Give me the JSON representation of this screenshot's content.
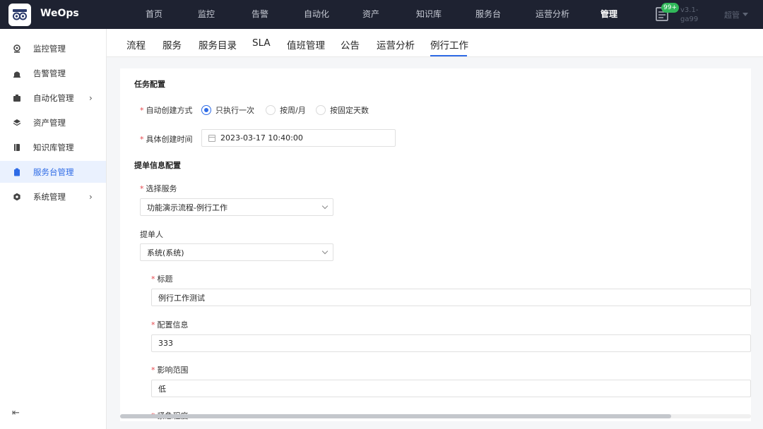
{
  "header": {
    "app_name": "WeOps",
    "nav": [
      "首页",
      "监控",
      "告警",
      "自动化",
      "资产",
      "知识库",
      "服务台",
      "运营分析",
      "管理"
    ],
    "active_nav": "管理",
    "notification_badge": "99+",
    "version_line1": "v3.1-",
    "version_line2": "ga99",
    "user": "超管"
  },
  "sidebar": {
    "items": [
      {
        "label": "监控管理",
        "icon": "monitor-icon"
      },
      {
        "label": "告警管理",
        "icon": "alarm-icon"
      },
      {
        "label": "自动化管理",
        "icon": "automation-icon",
        "has_children": true
      },
      {
        "label": "资产管理",
        "icon": "asset-icon"
      },
      {
        "label": "知识库管理",
        "icon": "book-icon"
      },
      {
        "label": "服务台管理",
        "icon": "clipboard-icon",
        "active": true
      },
      {
        "label": "系统管理",
        "icon": "settings-icon",
        "has_children": true
      }
    ]
  },
  "tabs": [
    "流程",
    "服务",
    "服务目录",
    "SLA",
    "值班管理",
    "公告",
    "运营分析",
    "例行工作"
  ],
  "active_tab": "例行工作",
  "form": {
    "task_config_title": "任务配置",
    "create_mode_label": "自动创建方式",
    "create_mode_options": [
      "只执行一次",
      "按周/月",
      "按固定天数"
    ],
    "create_mode_selected": "只执行一次",
    "create_time_label": "具体创建时间",
    "create_time_value": "2023-03-17 10:40:00",
    "ticket_config_title": "提单信息配置",
    "service_label": "选择服务",
    "service_value": "功能演示流程-例行工作",
    "submitter_label": "提单人",
    "submitter_value": "系统(系统)",
    "title_label": "标题",
    "title_value": "例行工作测试",
    "config_label": "配置信息",
    "config_value": "333",
    "impact_label": "影响范围",
    "impact_value": "低",
    "urgency_label": "紧急程度"
  }
}
